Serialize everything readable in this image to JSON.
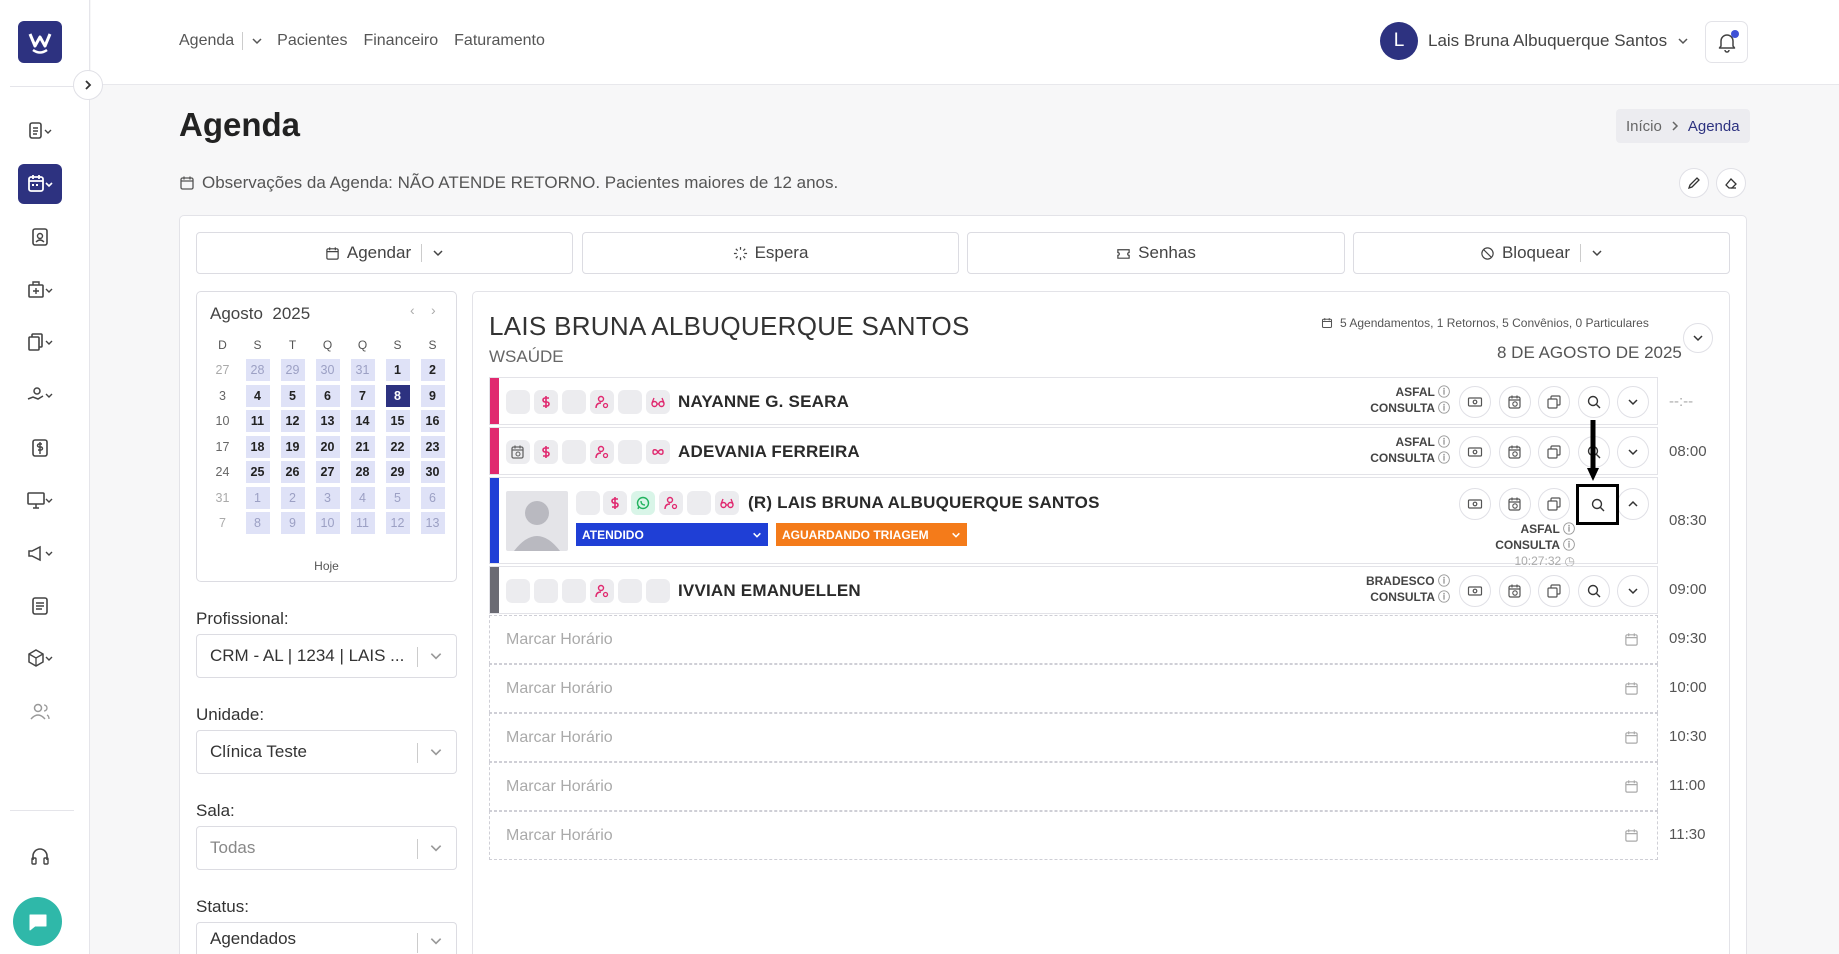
{
  "topnav": {
    "agenda": "Agenda",
    "pacientes": "Pacientes",
    "financeiro": "Financeiro",
    "faturamento": "Faturamento"
  },
  "user": {
    "initial": "L",
    "name": "Lais Bruna Albuquerque Santos"
  },
  "page": {
    "title": "Agenda",
    "breadcrumb_home": "Início",
    "breadcrumb_current": "Agenda",
    "observation": "Observações da Agenda: NÃO ATENDE RETORNO. Pacientes maiores de 12 anos."
  },
  "actions": {
    "agendar": "Agendar",
    "espera": "Espera",
    "senhas": "Senhas",
    "bloquear": "Bloquear"
  },
  "calendar": {
    "month": "Agosto",
    "year": "2025",
    "today": "Hoje",
    "weekdays": [
      "D",
      "S",
      "T",
      "Q",
      "Q",
      "S",
      "S"
    ],
    "weeks": [
      [
        "27",
        "28",
        "29",
        "30",
        "31",
        "1",
        "2"
      ],
      [
        "3",
        "4",
        "5",
        "6",
        "7",
        "8",
        "9"
      ],
      [
        "10",
        "11",
        "12",
        "13",
        "14",
        "15",
        "16"
      ],
      [
        "17",
        "18",
        "19",
        "20",
        "21",
        "22",
        "23"
      ],
      [
        "24",
        "25",
        "26",
        "27",
        "28",
        "29",
        "30"
      ],
      [
        "31",
        "1",
        "2",
        "3",
        "4",
        "5",
        "6"
      ],
      [
        "7",
        "8",
        "9",
        "10",
        "11",
        "12",
        "13"
      ]
    ],
    "selected": "8"
  },
  "filters": {
    "profissional_label": "Profissional:",
    "profissional_value": "CRM - AL | 1234 | LAIS ...",
    "unidade_label": "Unidade:",
    "unidade_value": "Clínica Teste",
    "sala_label": "Sala:",
    "sala_value": "Todas",
    "status_label": "Status:",
    "status_value": "Agendados"
  },
  "agenda": {
    "doctor": "LAIS BRUNA ALBUQUERQUE SANTOS",
    "clinic": "WSAÚDE",
    "summary": "5 Agendamentos, 1 Retornos, 5 Convênios, 0 Particulares",
    "date": "8 DE AGOSTO DE 2025"
  },
  "appointments": [
    {
      "name": "NAYANNE G. SEARA",
      "convenio": "ASFAL",
      "tipo": "CONSULTA",
      "time": "--:--"
    },
    {
      "name": "ADEVANIA FERREIRA",
      "convenio": "ASFAL",
      "tipo": "CONSULTA",
      "time": "08:00"
    },
    {
      "name": "(R) LAIS BRUNA ALBUQUERQUE SANTOS",
      "convenio": "ASFAL",
      "tipo": "CONSULTA",
      "time": "08:30",
      "status": "ATENDIDO",
      "triagem": "AGUARDANDO TRIAGEM",
      "clock": "10:27:32"
    },
    {
      "name": "IVVIAN EMANUELLEN",
      "convenio": "BRADESCO",
      "tipo": "CONSULTA",
      "time": "09:00"
    }
  ],
  "slots": [
    {
      "label": "Marcar Horário",
      "time": "09:30"
    },
    {
      "label": "Marcar Horário",
      "time": "10:00"
    },
    {
      "label": "Marcar Horário",
      "time": "10:30"
    },
    {
      "label": "Marcar Horário",
      "time": "11:00"
    },
    {
      "label": "Marcar Horário",
      "time": "11:30"
    }
  ],
  "colors": {
    "brand": "#2d3280",
    "pink": "#e0296f",
    "gray": "#6b6b73",
    "atendido": "#1f3fd6",
    "triagem": "#f47b1a",
    "chat": "#2fb8a9"
  },
  "icons": [
    "logo-icon",
    "chevron-right-icon",
    "clipboard-icon",
    "calendar-icon",
    "contact-icon",
    "hospital-icon",
    "documents-icon",
    "hand-coins-icon",
    "dollar-icon",
    "monitor-icon",
    "megaphone-icon",
    "newspaper-icon",
    "package-icon",
    "users-icon",
    "headset-icon",
    "chat-icon",
    "bell-icon",
    "search-icon",
    "money-icon",
    "calendar-clock-icon",
    "copy-icon"
  ]
}
